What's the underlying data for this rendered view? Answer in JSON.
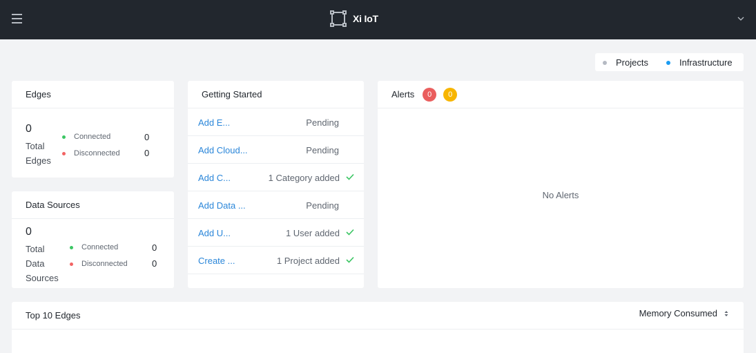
{
  "header": {
    "brand_name": "Xi IoT"
  },
  "view_toggle": {
    "options": [
      {
        "label": "Projects",
        "color": "#b5bac3"
      },
      {
        "label": "Infrastructure",
        "color": "#1b9cf2"
      }
    ]
  },
  "edges_card": {
    "title": "Edges",
    "total_value": "0",
    "total_label": [
      "Total",
      "Edges"
    ],
    "connected_label": "Connected",
    "connected_count": "0",
    "disconnected_label": "Disconnected",
    "disconnected_count": "0"
  },
  "datasources_card": {
    "title": "Data Sources",
    "total_value": "0",
    "total_label": [
      "Total",
      "Data",
      "Sources"
    ],
    "connected_label": "Connected",
    "connected_count": "0",
    "disconnected_label": "Disconnected",
    "disconnected_count": "0"
  },
  "getting_started": {
    "title": "Getting Started",
    "items": [
      {
        "link": "Add E...",
        "status": "Pending",
        "done": false
      },
      {
        "link": "Add Cloud...",
        "status": "Pending",
        "done": false
      },
      {
        "link": "Add C...",
        "status": "1 Category added",
        "done": true
      },
      {
        "link": "Add Data ...",
        "status": "Pending",
        "done": false
      },
      {
        "link": "Add U...",
        "status": "1 User added",
        "done": true
      },
      {
        "link": "Create ...",
        "status": "1 Project added",
        "done": true
      }
    ]
  },
  "alerts_card": {
    "title": "Alerts",
    "critical_count": "0",
    "warning_count": "0",
    "empty_text": "No Alerts"
  },
  "top_edges_card": {
    "title": "Top 10 Edges",
    "sort_label": "Memory Consumed"
  },
  "colors": {
    "connected": "#3cc664",
    "disconnected": "#f26363",
    "critical_badge": "#ea5e5e",
    "warning_badge": "#f7b500",
    "link": "#2a86d9",
    "check": "#3cc664"
  }
}
